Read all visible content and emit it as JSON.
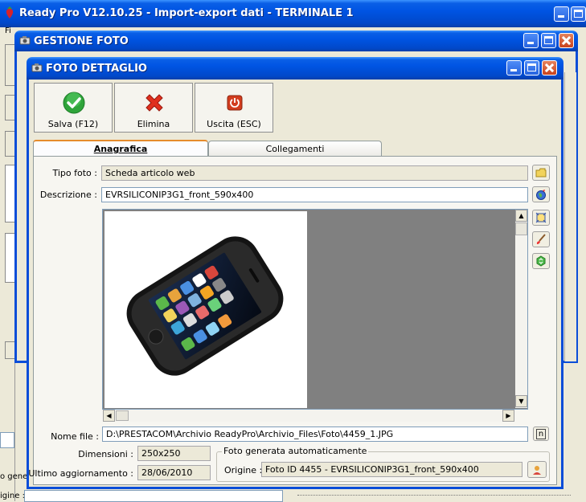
{
  "main_window": {
    "title": "Ready Pro V12.10.25 - Import-export dati - TERMINALE 1"
  },
  "gestione_window": {
    "title": "GESTIONE FOTO"
  },
  "dialog": {
    "title": "FOTO DETTAGLIO",
    "toolbar": {
      "save_label": "Salva (F12)",
      "delete_label": "Elimina",
      "exit_label": "Uscita (ESC)"
    },
    "tabs": [
      {
        "label": "Anagrafica"
      },
      {
        "label": "Collegamenti"
      }
    ],
    "form": {
      "tipo_foto_label": "Tipo foto :",
      "tipo_foto_value": "Scheda articolo web",
      "descrizione_label": "Descrizione :",
      "descrizione_value": "EVRSILICONIP3G1_front_590x400",
      "nome_file_label": "Nome file :",
      "nome_file_value": "D:\\PRESTACOM\\Archivio ReadyPro\\Archivio_Files\\Foto\\4459_1.JPG",
      "nome_file_button": "n",
      "dimensioni_label": "Dimensioni :",
      "dimensioni_value": "250x250",
      "ultimo_agg_label": "Ultimo aggiornamento :",
      "ultimo_agg_value": "28/06/2010",
      "group_title": "Foto generata automaticamente",
      "origine_label": "Origine :",
      "origine_value": "Foto ID 4455 - EVRSILICONIP3G1_front_590x400"
    }
  },
  "background_fragments": {
    "menu_f": "Fi",
    "left_label_1": "o gener",
    "left_label_2": "igine :"
  },
  "colors": {
    "titlebar": "#0054E3",
    "face": "#ECE9D8",
    "preview_gray": "#808080",
    "save_green": "#2FA43A",
    "delete_red": "#E0301E",
    "exit_red": "#D23C1E"
  }
}
